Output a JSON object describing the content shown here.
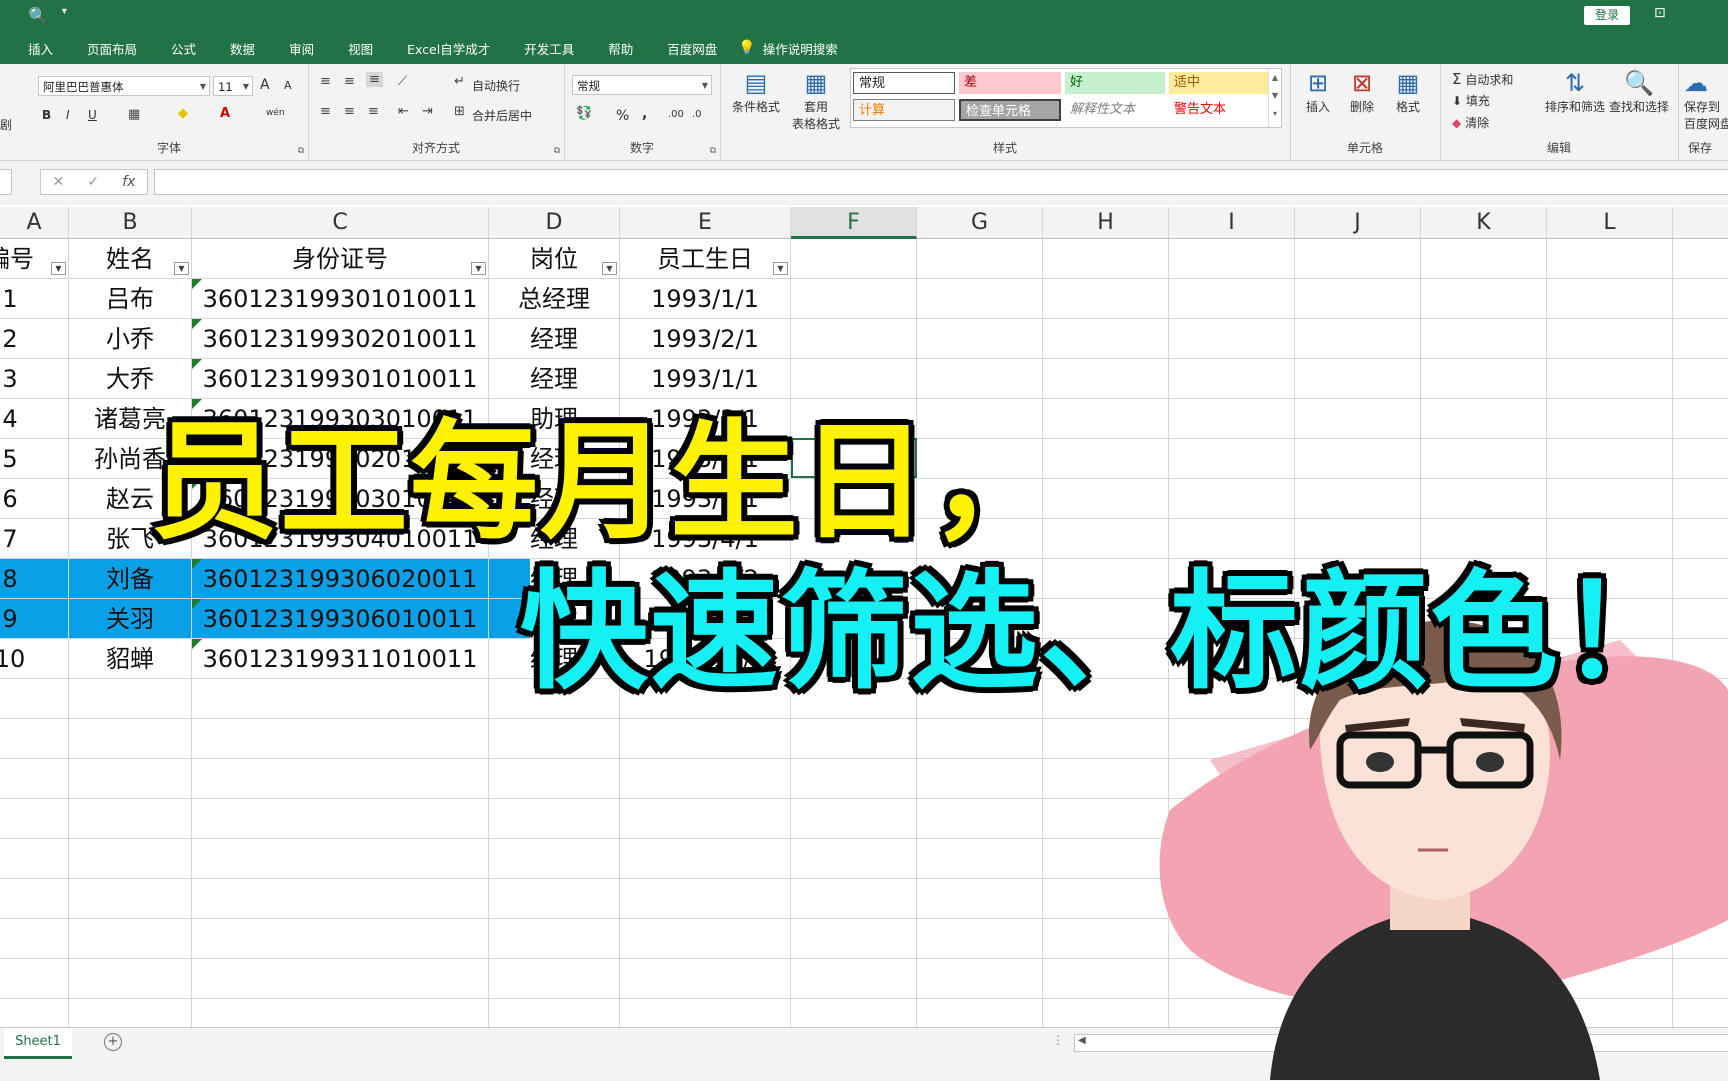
{
  "titlebar": {
    "login_label": "登录",
    "qat_icons": [
      "print-preview-icon",
      "qat-dropdown-icon"
    ],
    "window_icon": "ribbon-display-icon"
  },
  "tabs": [
    "插入",
    "页面布局",
    "公式",
    "数据",
    "审阅",
    "视图",
    "Excel自学成才",
    "开发工具",
    "帮助",
    "百度网盘"
  ],
  "tell_me": "操作说明搜索",
  "ribbon": {
    "font": {
      "name": "阿里巴巴普惠体",
      "size": "11",
      "group_label": "字体",
      "bold": "B",
      "italic": "I",
      "underline": "U",
      "grow": "A",
      "shrink": "A",
      "wen": "wén"
    },
    "alignment": {
      "wrap_label": "自动换行",
      "merge_label": "合并后居中",
      "group_label": "对齐方式"
    },
    "number": {
      "format": "常规",
      "percent": "%",
      "comma": ",",
      "inc_decimal": ".00",
      "dec_decimal": ".0",
      "group_label": "数字"
    },
    "styles": {
      "conditional_label": "条件格式",
      "table_label_1": "套用",
      "table_label_2": "表格格式",
      "group_label": "样式",
      "cells": [
        {
          "label": "常规",
          "bg": "#ffffff",
          "fg": "#222222"
        },
        {
          "label": "差",
          "bg": "#ffc7ce",
          "fg": "#9c0006"
        },
        {
          "label": "好",
          "bg": "#c6efce",
          "fg": "#006100"
        },
        {
          "label": "适中",
          "bg": "#ffeb9c",
          "fg": "#9c5700"
        },
        {
          "label": "计算",
          "bg": "#f2f2f2",
          "fg": "#fa7d00"
        },
        {
          "label": "检查单元格",
          "bg": "#a5a5a5",
          "fg": "#ffffff"
        },
        {
          "label": "解释性文本",
          "bg": "#ffffff",
          "fg": "#7f7f7f"
        },
        {
          "label": "警告文本",
          "bg": "#ffffff",
          "fg": "#ff0000"
        }
      ]
    },
    "cells": {
      "insert": "插入",
      "delete": "删除",
      "format": "格式",
      "group_label": "单元格"
    },
    "editing": {
      "autosum": "自动求和",
      "fill": "填充",
      "clear": "清除",
      "sort": "排序和筛选",
      "find": "查找和选择",
      "group_label": "编辑"
    },
    "save": {
      "label_1": "保存到",
      "label_2": "百度网盘",
      "group_label": "保存"
    },
    "left_partial": "剧"
  },
  "formula_bar": {
    "cancel": "✕",
    "enter": "✓",
    "fx": "fx",
    "value": ""
  },
  "columns": [
    "A",
    "B",
    "C",
    "D",
    "E",
    "F",
    "G",
    "H",
    "I",
    "J",
    "K",
    "L"
  ],
  "table": {
    "headers": [
      "编号",
      "姓名",
      "身份证号",
      "岗位",
      "员工生日"
    ],
    "rows": [
      [
        "1",
        "吕布",
        "360123199301010011",
        "总经理",
        "1993/1/1"
      ],
      [
        "2",
        "小乔",
        "360123199302010011",
        "经理",
        "1993/2/1"
      ],
      [
        "3",
        "大乔",
        "360123199301010011",
        "经理",
        "1993/1/1"
      ],
      [
        "4",
        "诸葛亮",
        "360123199303010011",
        "助理",
        "1993/3/1"
      ],
      [
        "5",
        "孙尚香",
        "360123199302010011",
        "经理",
        "1993/2/1"
      ],
      [
        "6",
        "赵云",
        "360123199303010011",
        "经理",
        "1993/3/1"
      ],
      [
        "7",
        "张飞",
        "360123199304010011",
        "经理",
        "1993/4/1"
      ],
      [
        "8",
        "刘备",
        "360123199306020011",
        "经理",
        "1993/6/2"
      ],
      [
        "9",
        "关羽",
        "360123199306010011",
        "经理",
        "1993/6/1"
      ],
      [
        "10",
        "貂蝉",
        "360123199311010011",
        "经理",
        "1993/11/1"
      ]
    ],
    "highlight_color": "#0aa0e8"
  },
  "sheet_tabs": [
    "Sheet1"
  ],
  "overlay": {
    "line1": "员工每月生日，",
    "line2": "快速筛选、标颜色！",
    "color1": "#fff200",
    "color2": "#15f0f5"
  }
}
